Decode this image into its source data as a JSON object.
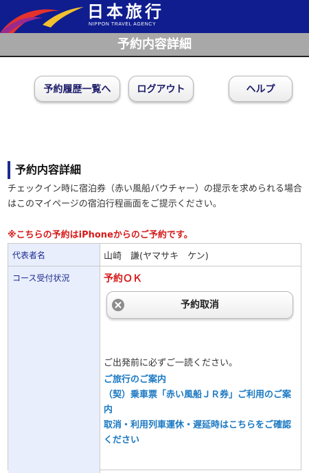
{
  "header": {
    "brand_name": "日本旅行",
    "brand_sub": "NIPPON TRAVEL AGENCY",
    "page_title": "予約内容詳細",
    "colors": {
      "bar": "#0f1d8f",
      "swoosh_red": "#e5322d",
      "swoosh_yellow": "#f2c12e",
      "swoosh_purple": "#9a2a8f"
    }
  },
  "nav": {
    "history_label": "予約履歴一覧へ",
    "logout_label": "ログアウト",
    "help_label": "ヘルプ"
  },
  "section": {
    "heading": "予約内容詳細",
    "notice": "チェックイン時に宿泊券（赤い風船バウチャー）の提示を求められる場合はこのマイページの宿泊行程画面をご提示ください。",
    "warning": "※こちらの予約はiPhoneからのご予約です。"
  },
  "table": {
    "rows": [
      {
        "label": "代表者名",
        "value": "山崎　謙(ヤマサキ　ケン)"
      },
      {
        "label": "コース受付状況",
        "value": "予約ＯＫ"
      }
    ],
    "cancel_button": "予約取消",
    "note": "ご出発前に必ずご一読ください。",
    "links": [
      "ご旅行のご案内",
      "（契）乗車票「赤い風船ＪＲ券」ご利用のご案内",
      "取消・利用列車運休・遅延時はこちらをご確認ください"
    ]
  }
}
